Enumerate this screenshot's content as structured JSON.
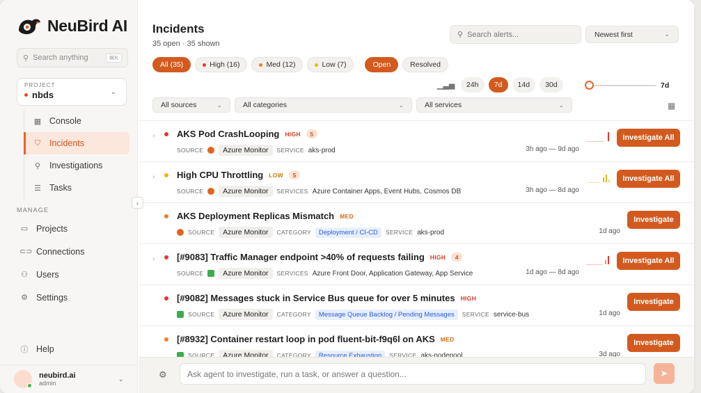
{
  "brand": {
    "name": "NeuBird AI",
    "accent": "#d35a1f"
  },
  "sidebar": {
    "search_placeholder": "Search anything",
    "search_shortcut": "⌘K",
    "project_label": "PROJECT",
    "project_name": "nbds",
    "nav": [
      {
        "label": "Console",
        "icon": "grid-icon"
      },
      {
        "label": "Incidents",
        "icon": "shield-icon",
        "active": true
      },
      {
        "label": "Investigations",
        "icon": "search-icon"
      },
      {
        "label": "Tasks",
        "icon": "list-icon"
      }
    ],
    "manage_label": "MANAGE",
    "manage": [
      {
        "label": "Projects",
        "icon": "folder-icon"
      },
      {
        "label": "Connections",
        "icon": "link-icon"
      },
      {
        "label": "Users",
        "icon": "users-icon"
      },
      {
        "label": "Settings",
        "icon": "gear-icon"
      }
    ],
    "help": "Help",
    "user": {
      "name": "neubird.ai",
      "role": "admin"
    }
  },
  "header": {
    "title": "Incidents",
    "subtitle": "35 open · 35 shown",
    "search_placeholder": "Search alerts...",
    "sort": "Newest first"
  },
  "filters": {
    "severity": [
      {
        "label": "All (35)",
        "on": true
      },
      {
        "label": "High (16)",
        "color": "#e03b2b"
      },
      {
        "label": "Med (12)",
        "color": "#ef7f2a"
      },
      {
        "label": "Low (7)",
        "color": "#e8b80f"
      }
    ],
    "status": [
      {
        "label": "Open",
        "on": true
      },
      {
        "label": "Resolved"
      }
    ],
    "ranges": [
      "24h",
      "7d",
      "14d",
      "30d"
    ],
    "active_range": "7d",
    "slider_value": "7d",
    "sources": "All sources",
    "categories": "All categories",
    "services": "All services"
  },
  "incidents": [
    {
      "title": "AKS Pod CrashLooping",
      "severity": "HIGH",
      "count": "5",
      "source": "Azure Monitor",
      "svc_key": "SERVICE",
      "svc": "aks-prod",
      "time": "3h ago — 9d ago",
      "action": "Investigate All"
    },
    {
      "title": "High CPU Throttling",
      "severity": "LOW",
      "count": "5",
      "source": "Azure Monitor",
      "svc_key": "SERVICES",
      "svc": "Azure Container Apps, Event Hubs, Cosmos DB",
      "time": "3h ago — 8d ago",
      "action": "Investigate All"
    },
    {
      "title": "AKS Deployment Replicas Mismatch",
      "severity": "MED",
      "source": "Azure Monitor",
      "category": "Deployment / CI-CD",
      "svc_key": "SERVICE",
      "svc": "aks-prod",
      "time": "1d ago",
      "action": "Investigate"
    },
    {
      "title": "[#9083] Traffic Manager endpoint >40% of requests failing",
      "severity": "HIGH",
      "count": "4",
      "source": "Azure Monitor",
      "svc_key": "SERVICES",
      "svc": "Azure Front Door, Application Gateway, App Service",
      "time": "1d ago — 8d ago",
      "action": "Investigate All"
    },
    {
      "title": "[#9082] Messages stuck in Service Bus queue for over 5 minutes",
      "severity": "HIGH",
      "source": "Azure Monitor",
      "category": "Message Queue Backlog / Pending Messages",
      "svc_key": "SERVICE",
      "svc": "service-bus",
      "time": "1d ago",
      "action": "Investigate"
    },
    {
      "title": "[#8932] Container restart loop in pod fluent-bit-f9q6l on AKS",
      "severity": "MED",
      "source": "Azure Monitor",
      "category": "Resource Exhaustion",
      "svc_key": "SERVICE",
      "svc": "aks-nodepool",
      "time": "3d ago",
      "action": "Investigate"
    }
  ],
  "labels": {
    "source": "SOURCE",
    "category": "CATEGORY"
  },
  "agent": {
    "placeholder": "Ask agent to investigate, run a task, or answer a question..."
  }
}
